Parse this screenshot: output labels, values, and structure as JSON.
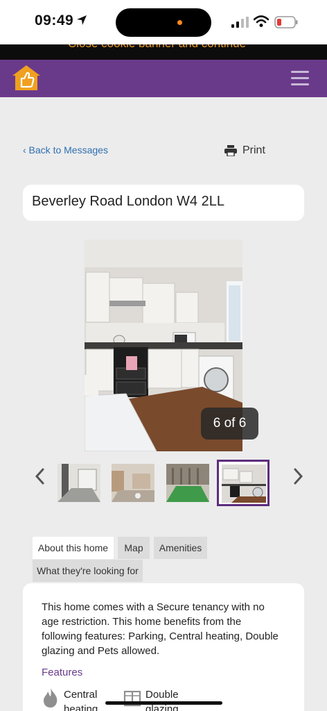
{
  "status": {
    "time": "09:49"
  },
  "cookie": {
    "text": "Close cookie banner and continue"
  },
  "nav": {
    "back": "‹ Back to Messages",
    "print": "Print"
  },
  "listing": {
    "title": "Beverley Road London W4 2LL"
  },
  "gallery": {
    "counter": "6 of 6",
    "current": 6,
    "total": 6
  },
  "tabs": [
    "About this home",
    "Map",
    "Amenities",
    "What they're looking for"
  ],
  "about": {
    "description": "This home comes with a Secure tenancy with no age restriction. This home benefits from the following features: Parking, Central heating, Double glazing and Pets allowed.",
    "features_heading": "Features",
    "features": [
      "Central heating",
      "Double glazing"
    ]
  },
  "colors": {
    "brand": "#6a3a8a",
    "accent": "#e89a22",
    "link": "#2f6fb0"
  }
}
